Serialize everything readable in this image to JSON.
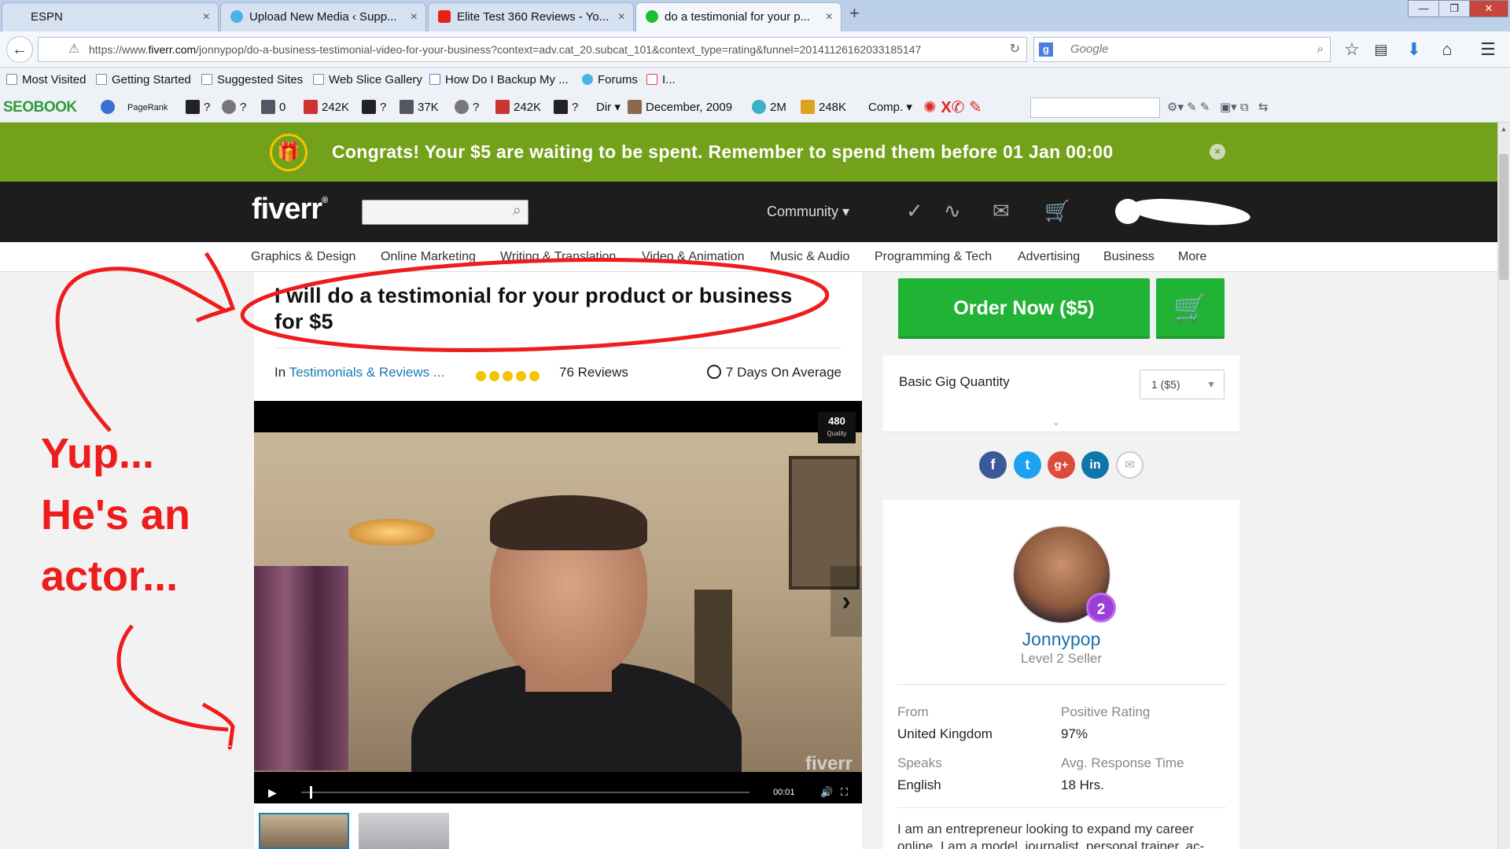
{
  "browser": {
    "tabs": [
      {
        "title": "ESPN",
        "active": false
      },
      {
        "title": "Upload New Media ‹ Supp...",
        "active": false
      },
      {
        "title": "Elite Test 360 Reviews - Yo...",
        "active": false
      },
      {
        "title": "do a testimonial for your p...",
        "active": true
      }
    ],
    "tab_close": "×",
    "new_tab": "+",
    "window_buttons": {
      "minimize": "—",
      "maximize": "❐",
      "close": "✕"
    },
    "url_prefix": "https://www.",
    "url_host": "fiverr.com",
    "url_path": "/jonnypop/do-a-business-testimonial-video-for-your-business?context=adv.cat_20.subcat_101&context_type=rating&funnel=2014112616203318514​7",
    "search_engine": "Google",
    "bookmarks": [
      "Most Visited",
      "Getting Started",
      "Suggested Sites",
      "Web Slice Gallery",
      "How Do I Backup My ...",
      "Forums",
      "I..."
    ],
    "seo_toolbar": {
      "logo": "SEOBOOK",
      "pagerank": "PageRank",
      "items": [
        "?",
        "?",
        "0",
        "242K",
        "?",
        "37K",
        "?",
        "242K",
        "?",
        "Dir",
        "December, 2009",
        "2M",
        "248K",
        "Comp."
      ]
    }
  },
  "promo": {
    "text": "Congrats! Your $5 are waiting to be spent. Remember to spend them before 01 Jan 00:00",
    "close": "×"
  },
  "header": {
    "logo": "fiverr",
    "logo_mark": "®",
    "community": "Community ▾"
  },
  "categories": [
    "Graphics & Design",
    "Online Marketing",
    "Writing & Translation",
    "Video & Animation",
    "Music & Audio",
    "Programming & Tech",
    "Advertising",
    "Business",
    "More"
  ],
  "gig": {
    "title": "I will do a testimonial for your product or business for $5",
    "in_label": "In ",
    "category_link": "Testimonials & Reviews ...",
    "rating": 5,
    "reviews": "76 Reviews",
    "delivery": "7 Days On Average"
  },
  "video": {
    "quality": "480",
    "quality_label": "Quality",
    "watermark": "fiverr",
    "timecode": "00:01",
    "progress": 0.02
  },
  "order": {
    "button": "Order Now ($5)",
    "quantity_label": "Basic Gig Quantity",
    "quantity_value": "1 ($5)"
  },
  "share": [
    "f",
    "t",
    "g+",
    "in",
    "✉"
  ],
  "seller": {
    "name": "Jonnypop",
    "level": "Level 2 Seller",
    "level_badge": "2",
    "from_label": "From",
    "from_value": "United Kingdom",
    "rating_label": "Positive Rating",
    "rating_value": "97%",
    "speaks_label": "Speaks",
    "speaks_value": "English",
    "response_label": "Avg. Response Time",
    "response_value": "18 Hrs.",
    "bio": "I am an entrepreneur looking to expand my career online. I am a model, journalist, personal trainer, ac-"
  },
  "annotation": {
    "line1": "Yup...",
    "line2": "He's an",
    "line3": "actor...",
    "color": "#ee1c1c"
  }
}
